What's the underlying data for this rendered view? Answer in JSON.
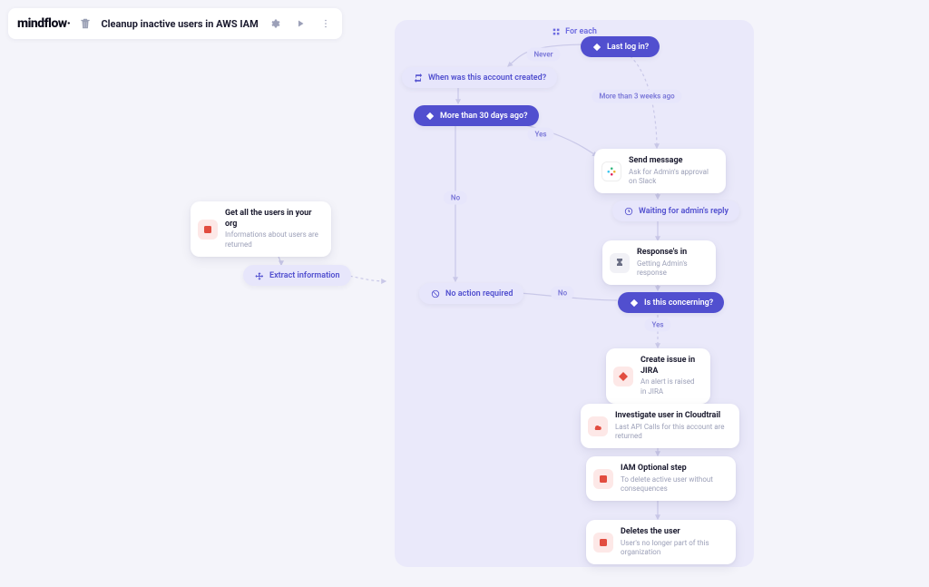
{
  "header": {
    "brand_prefix": "mindflow",
    "brand_suffix": "·",
    "workflow_title": "Cleanup inactive users in AWS IAM"
  },
  "panel": {
    "title": "For each"
  },
  "nodes": {
    "get_users": {
      "title": "Get all the users in your org",
      "sub": "Informations about users are returned"
    },
    "extract": {
      "label": "Extract information"
    },
    "last_login": {
      "label": "Last log in?"
    },
    "account_created": {
      "label": "When was this account created?"
    },
    "more30": {
      "label": "More than 30 days ago?"
    },
    "send_msg": {
      "title": "Send message",
      "sub": "Ask for Admin's approval on Slack"
    },
    "waiting": {
      "label": "Waiting for admin's reply"
    },
    "response_in": {
      "title": "Response's in",
      "sub": "Getting Admin's response"
    },
    "no_action": {
      "label": "No action required"
    },
    "concerning": {
      "label": "Is this concerning?"
    },
    "jira": {
      "title": "Create issue in JIRA",
      "sub": "An alert is raised in JIRA"
    },
    "cloudtrail": {
      "title": "Investigate user in Cloudtrail",
      "sub": "Last API Calls for this account are returned"
    },
    "iam_opt": {
      "title": "IAM Optional step",
      "sub": "To delete active user without consequences"
    },
    "delete": {
      "title": "Deletes the user",
      "sub": "User's no longer part of this organization"
    }
  },
  "badges": {
    "never": "Never",
    "more3w": "More than 3 weeks ago",
    "yes1": "Yes",
    "no1": "No",
    "no2": "No",
    "yes2": "Yes"
  }
}
